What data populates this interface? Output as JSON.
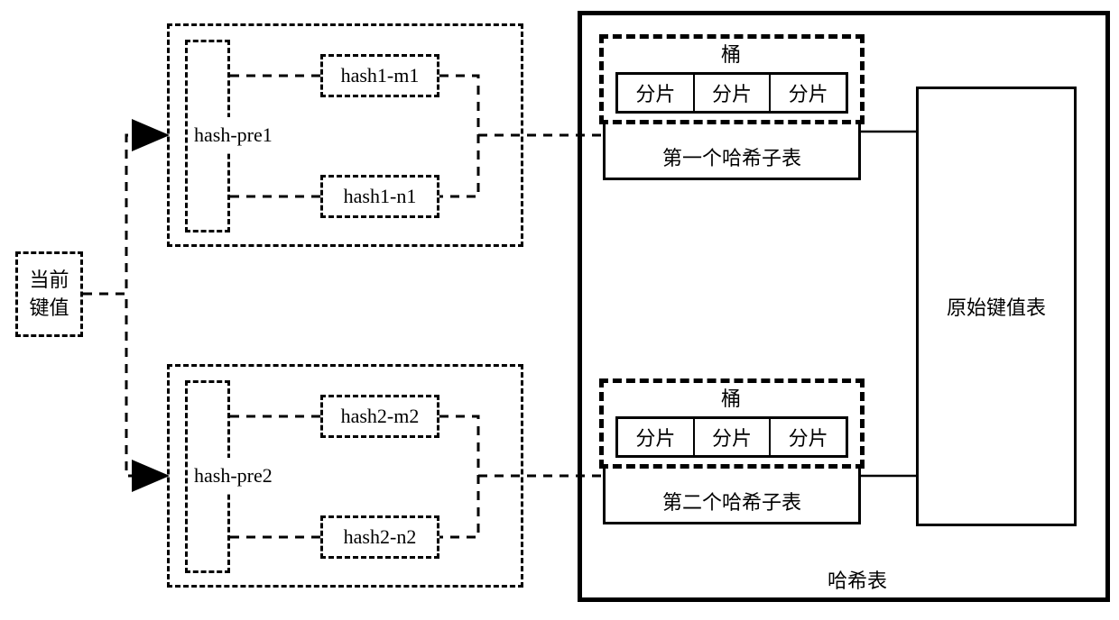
{
  "left": {
    "current_key_l1": "当前",
    "current_key_l2": "键值",
    "pre1": "hash-pre1",
    "pre2": "hash-pre2",
    "h1m1": "hash1-m1",
    "h1n1": "hash1-n1",
    "h2m2": "hash2-m2",
    "h2n2": "hash2-n2"
  },
  "right": {
    "bucket": "桶",
    "shard": "分片",
    "subtable1": "第一个哈希子表",
    "subtable2": "第二个哈希子表",
    "original": "原始键值表",
    "hashtable": "哈希表"
  }
}
